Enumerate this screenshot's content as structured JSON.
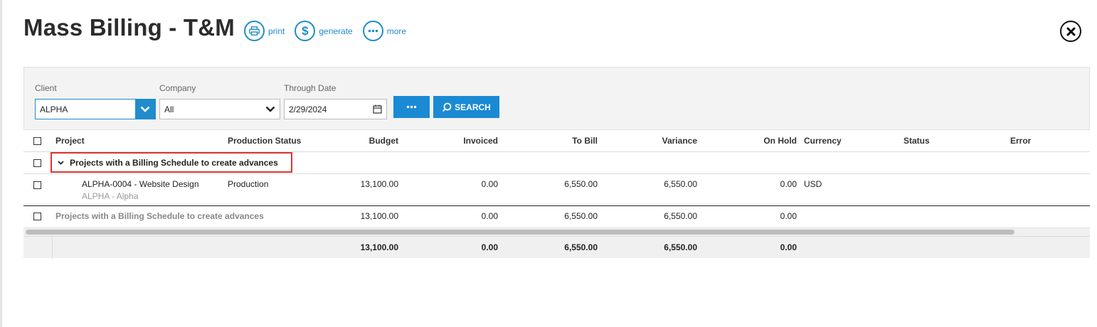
{
  "header": {
    "title": "Mass Billing - T&M",
    "actions": {
      "print": "print",
      "generate": "generate",
      "more": "more"
    }
  },
  "filters": {
    "client_label": "Client",
    "client_value": "ALPHA",
    "company_label": "Company",
    "company_value": "All",
    "date_label": "Through Date",
    "date_value": "2/29/2024",
    "search_label": "SEARCH"
  },
  "columns": {
    "project": "Project",
    "production_status": "Production Status",
    "budget": "Budget",
    "invoiced": "Invoiced",
    "to_bill": "To Bill",
    "variance": "Variance",
    "on_hold": "On Hold",
    "currency": "Currency",
    "status": "Status",
    "error": "Error"
  },
  "group": {
    "label": "Projects with a Billing Schedule to create advances"
  },
  "rows": [
    {
      "project": "ALPHA-0004 - Website Design",
      "client": "ALPHA - Alpha",
      "production_status": "Production",
      "budget": "13,100.00",
      "invoiced": "0.00",
      "to_bill": "6,550.00",
      "variance": "6,550.00",
      "on_hold": "0.00",
      "currency": "USD"
    }
  ],
  "subtotal": {
    "label": "Projects with a Billing Schedule to create advances",
    "budget": "13,100.00",
    "invoiced": "0.00",
    "to_bill": "6,550.00",
    "variance": "6,550.00",
    "on_hold": "0.00"
  },
  "totals": {
    "budget": "13,100.00",
    "invoiced": "0.00",
    "to_bill": "6,550.00",
    "variance": "6,550.00",
    "on_hold": "0.00"
  },
  "colors": {
    "accent": "#1a8ad4",
    "highlight": "#d9372e"
  }
}
